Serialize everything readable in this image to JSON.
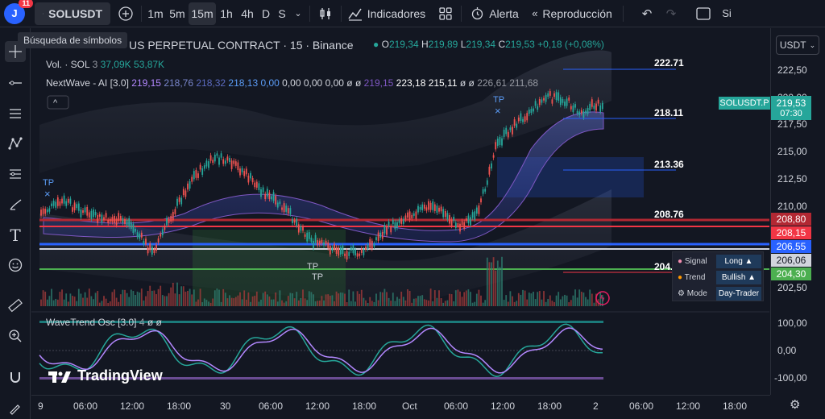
{
  "topbar": {
    "avatar_letter": "J",
    "notification_count": "11",
    "symbol": "SOLUSDT",
    "timeframes": [
      "1m",
      "5m",
      "15m",
      "1h",
      "4h",
      "D",
      "S"
    ],
    "active_timeframe": "15m",
    "indicators_label": "Indicadores",
    "alert_label": "Alerta",
    "replay_label": "Reproducción",
    "right_partial": "Si"
  },
  "tooltip": {
    "text": "Búsqueda de símbolos"
  },
  "legend": {
    "title": "US PERPETUAL CONTRACT · 15 · Binance",
    "o_label": "O",
    "o": "219,34",
    "h_label": "H",
    "h": "219,89",
    "l_label": "L",
    "l": "219,34",
    "c_label": "C",
    "c": "219,53",
    "change": "+0,18 (+0,08%)",
    "volume_label": "Vol. · SOL",
    "volume_period": "3",
    "volume_a": "37,09K",
    "volume_b": "53,87K",
    "nextwave_label": "NextWave - AI [3.0]",
    "nextwave_values": [
      "219,15",
      "218,76",
      "218,32",
      "218,13",
      "0,00",
      "0,00",
      "0,00",
      "0,00",
      "ø",
      "ø",
      "219,15",
      "223,18",
      "215,11",
      "ø",
      "ø",
      "226,61",
      "211,68"
    ]
  },
  "price_axis": {
    "currency": "USDT",
    "ticks": [
      "222,50",
      "220,00",
      "217,50",
      "215,00",
      "212,50",
      "210,00",
      "207,50",
      "205,00",
      "202,50"
    ],
    "tags": [
      {
        "text": "219,53",
        "sub": "07:30",
        "color": "#26a69a"
      },
      {
        "text": "208,80",
        "color": "#b22833"
      },
      {
        "text": "208,15",
        "color": "#f23645"
      },
      {
        "text": "206,55",
        "color": "#2962ff"
      },
      {
        "text": "206,06",
        "color": "#d1d4dc"
      },
      {
        "text": "204,30",
        "color": "#4caf50"
      }
    ],
    "symbol_tag": "SOLUSDT.P"
  },
  "hlines": [
    {
      "label": "222.71"
    },
    {
      "label": "218.11"
    },
    {
      "label": "213.36"
    },
    {
      "label": "208.76"
    },
    {
      "label": "204."
    }
  ],
  "markers": {
    "tp": "TP"
  },
  "signal_panel": {
    "rows": [
      {
        "key": "Signal",
        "value": "Long ▲",
        "icon": "brain-icon"
      },
      {
        "key": "Trend",
        "value": "Bullish ▲",
        "icon": "fire-icon"
      },
      {
        "key": "Mode",
        "value": "Day-Trader",
        "icon": "gear-icon"
      }
    ]
  },
  "wavetrend": {
    "title": "WaveTrend Osc [3.0]",
    "param": "4",
    "extra": "ø ø",
    "ticks": [
      "100,00",
      "0,00",
      "-100,00"
    ]
  },
  "time_axis": {
    "labels": [
      "9",
      "06:00",
      "12:00",
      "18:00",
      "30",
      "06:00",
      "12:00",
      "18:00",
      "Oct",
      "06:00",
      "12:00",
      "18:00",
      "2",
      "06:00",
      "12:00",
      "18:00"
    ]
  },
  "brand": {
    "name": "TradingView"
  }
}
